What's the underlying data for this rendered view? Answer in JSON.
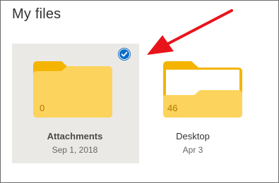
{
  "header": {
    "title": "My files"
  },
  "items": [
    {
      "name": "Attachments",
      "date": "Sep 1, 2018",
      "count": "0",
      "selected": true
    },
    {
      "name": "Desktop",
      "date": "Apr 3",
      "count": "46",
      "selected": false
    }
  ],
  "icons": {
    "folder": "folder-icon",
    "check": "checkmark-circle-icon",
    "annotation": "red-arrow-annotation"
  },
  "colors": {
    "folder_body": "#fcd35c",
    "folder_tab": "#f4b400",
    "selection_bg": "#ebe9e6",
    "check_blue": "#0b6cc7",
    "arrow_red": "#e8141b"
  }
}
